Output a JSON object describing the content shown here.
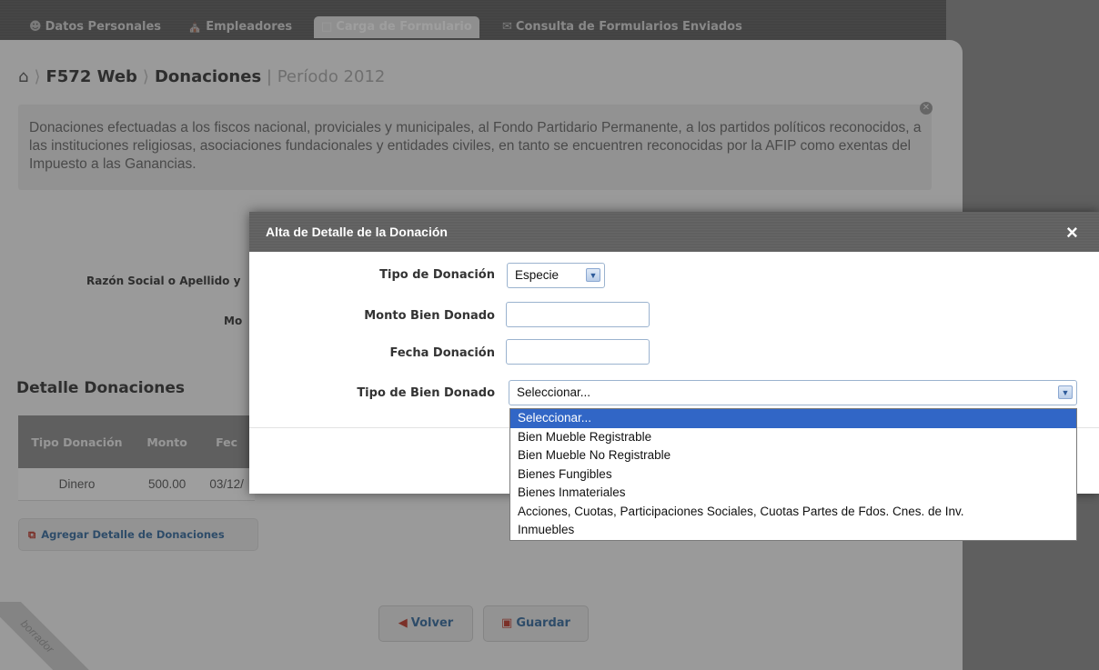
{
  "nav": {
    "tabs": [
      {
        "icon": "user-icon",
        "label": "Datos Personales"
      },
      {
        "icon": "building-icon",
        "label": "Empleadores"
      },
      {
        "icon": "document-icon",
        "label": "Carga de Formulario"
      },
      {
        "icon": "envelope-icon",
        "label": "Consulta de Formularios Enviados"
      }
    ]
  },
  "breadcrumb": {
    "home_icon": "home-icon",
    "app": "F572 Web",
    "section": "Donaciones",
    "period": "| Período 2012"
  },
  "info": {
    "text": "Donaciones efectuadas a los fiscos nacional, proviciales y municipales, al Fondo Partidario Permanente, a los partidos políticos reconocidos, a las instituciones religiosas, asociaciones fundacionales y entidades civiles, en tanto se encuentren reconocidas por la AFIP como exentas del Impuesto a las Ganancias."
  },
  "form": {
    "razon_social_label": "Razón Social o Apellido y",
    "monto_label": "Mo"
  },
  "detalle": {
    "title": "Detalle Donaciones",
    "columns": [
      "Tipo Donación",
      "Monto",
      "Fec"
    ],
    "rows": [
      [
        "Dinero",
        "500.00",
        "03/12/"
      ]
    ],
    "add_button": "Agregar Detalle de Donaciones"
  },
  "buttons": {
    "volver": "Volver",
    "guardar": "Guardar"
  },
  "watermark": "borrador",
  "modal": {
    "title": "Alta de Detalle de la Donación",
    "close": "×",
    "tipo_donacion_label": "Tipo de Donación",
    "tipo_donacion_value": "Especie",
    "monto_label": "Monto Bien Donado",
    "monto_value": "",
    "fecha_label": "Fecha Donación",
    "fecha_value": "",
    "tipo_bien_label": "Tipo de Bien Donado",
    "tipo_bien_value": "Seleccionar..."
  },
  "dropdown": {
    "options": [
      "Seleccionar...",
      "Bien Mueble Registrable",
      "Bien Mueble No Registrable",
      "Bienes Fungibles",
      "Bienes Inmateriales",
      "Acciones, Cuotas, Participaciones Sociales, Cuotas Partes de Fdos. Cnes. de Inv.",
      "Inmuebles"
    ],
    "selected_index": 0
  }
}
